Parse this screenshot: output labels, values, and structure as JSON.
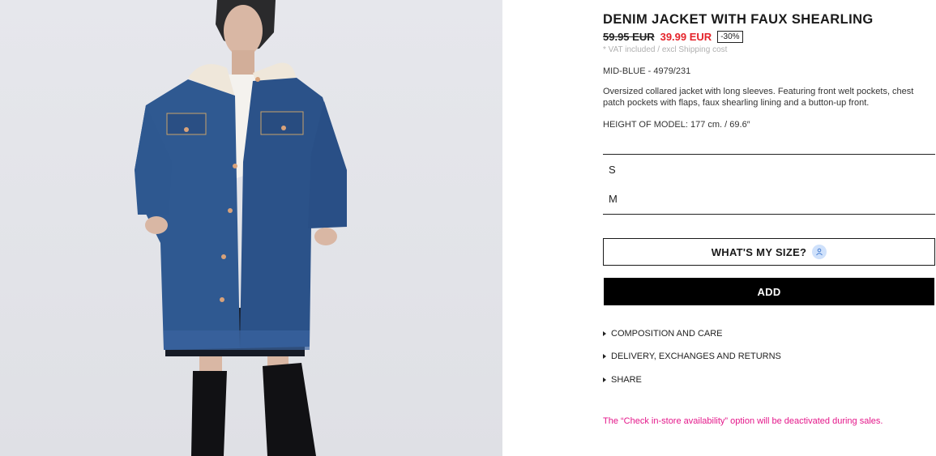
{
  "product": {
    "title": "DENIM JACKET WITH FAUX SHEARLING",
    "old_price": "59.95 EUR",
    "new_price": "39.99 EUR",
    "discount": "-30%",
    "vat_note": "* VAT included / excl Shipping cost",
    "color_ref": "MID-BLUE - 4979/231",
    "description": "Oversized collared jacket with long sleeves. Featuring front welt pockets, chest patch pockets with flaps, faux shearling lining and a button-up front.",
    "model_height": "HEIGHT OF MODEL: 177 cm. / 69.6″"
  },
  "sizes": [
    "S",
    "M"
  ],
  "buttons": {
    "whats_my_size": "WHAT'S MY SIZE?",
    "add": "ADD"
  },
  "accordion": [
    "COMPOSITION AND CARE",
    "DELIVERY, EXCHANGES AND RETURNS",
    "SHARE"
  ],
  "notice": "The “Check in-store availability” option will be deactivated during sales.",
  "icons": {
    "size_badge": "person-measure-icon",
    "accordion_marker": "triangle-right-icon"
  },
  "colors": {
    "sale_price": "#e5242b",
    "notice": "#e4178a",
    "add_button_bg": "#000000",
    "size_badge_bg": "#cfe1fb"
  }
}
